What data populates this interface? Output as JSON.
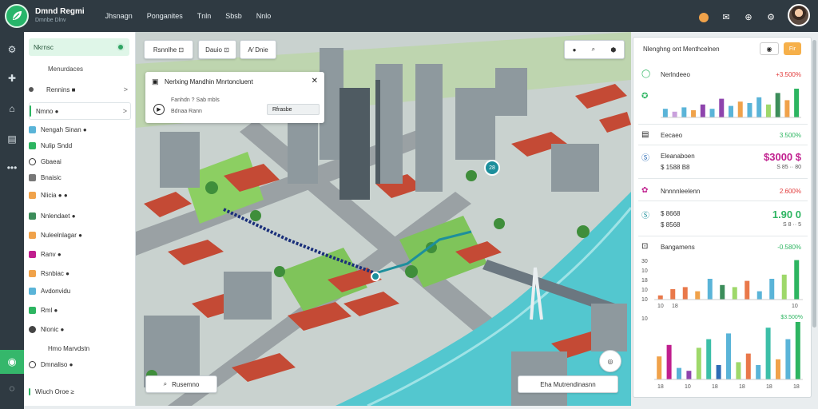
{
  "app": {
    "title": "Dmnd Regmi",
    "subtitle": "Dmnbe Dlnv"
  },
  "topnav": [
    "Jhsnagn",
    "Ponganites",
    "Tnln",
    "Sbsb",
    "Nnlo"
  ],
  "sidebar": {
    "header": "Nkrnsc",
    "menu_label": "Menurdaces",
    "items": [
      {
        "label": "Rennins ■",
        "chevron": ">"
      },
      {
        "label": "Nmno ●",
        "chevron": ">"
      },
      {
        "label": "Nengah Sinan ●"
      },
      {
        "label": "Nulip Sndd"
      },
      {
        "label": "Gbaeai"
      },
      {
        "label": "Bnaisic"
      },
      {
        "label": "Nlicia ● ●"
      },
      {
        "label": "Nnlendaet ●"
      },
      {
        "label": "Nuleelnlagar ●"
      },
      {
        "label": "Ranv ●"
      },
      {
        "label": "Rsnbiac ●"
      },
      {
        "label": "Avdonvidu"
      },
      {
        "label": "Rml ●"
      },
      {
        "label": "Nlonic ●"
      },
      {
        "label": "Hmo Marvdstn"
      },
      {
        "label": "Dmnaliso ●"
      },
      {
        "label": "Wiuch Oroe ≥"
      }
    ]
  },
  "map": {
    "toolbar": [
      "Rsnnlhe ⊡",
      "Dauio ⊡",
      "A⁄  Dnie"
    ],
    "popup": {
      "title": "Nerlxing Mandhin Mnrtoncluent",
      "line1": "Fanhdn ? Sab mbls",
      "line2": "Bdnaa Rann",
      "select": "Rfrasbe"
    },
    "pin_label": "28",
    "search_chip": "Rusemno",
    "bottom_chip": "Eha Mutrendinasnn"
  },
  "panel": {
    "title": "Nlenghng ont Menthcelnen",
    "btn_primary": "Fir",
    "metrics": [
      {
        "label": "Nerlndeeo",
        "value": "+3.500%",
        "color": "#e23b3b",
        "icon": "circle-icon"
      },
      {
        "label": "Eecaeo",
        "value": "3.500%",
        "color": "#2db561",
        "icon": "document-icon"
      },
      {
        "label": "Eleanaboen",
        "big": "$3000 $",
        "sub": "$ 1588 B8",
        "sub2": "S 85 ·· 80",
        "color": "#c01f8e",
        "icon": "dollar-icon"
      },
      {
        "label": "Nnnnnleelenn",
        "value": "2.600%",
        "color": "#e23b3b",
        "icon": "flower-icon"
      },
      {
        "label": "$ 8668",
        "big": "1.90 0",
        "sub": "$ 8568",
        "sub2": "S 8 ·· 5",
        "color": "#2db561",
        "icon": "money-icon"
      },
      {
        "label": "Bangamens",
        "value": "-0.580%",
        "color": "#2db561",
        "icon": "chart-icon"
      }
    ],
    "chart1_bars": [
      {
        "v": 0.3,
        "c": "#5ab4d8"
      },
      {
        "v": 0.2,
        "c": "#c9a0dc"
      },
      {
        "v": 0.35,
        "c": "#5ab4d8"
      },
      {
        "v": 0.25,
        "c": "#f0a24a"
      },
      {
        "v": 0.45,
        "c": "#8e44ad"
      },
      {
        "v": 0.3,
        "c": "#5ab4d8"
      },
      {
        "v": 0.65,
        "c": "#8e44ad"
      },
      {
        "v": 0.4,
        "c": "#5ab4d8"
      },
      {
        "v": 0.55,
        "c": "#f0a24a"
      },
      {
        "v": 0.5,
        "c": "#5ab4d8"
      },
      {
        "v": 0.7,
        "c": "#5ab4d8"
      },
      {
        "v": 0.45,
        "c": "#9ed86a"
      },
      {
        "v": 0.85,
        "c": "#3c8d5a"
      },
      {
        "v": 0.6,
        "c": "#f0a24a"
      },
      {
        "v": 1.0,
        "c": "#2db561"
      }
    ],
    "chart2": {
      "yticks": [
        "30",
        "10",
        "18",
        "10",
        "10"
      ],
      "xticks": [
        "10",
        "18",
        "10"
      ],
      "bars": [
        {
          "v": 0.1,
          "c": "#e9784a"
        },
        {
          "v": 0.25,
          "c": "#e9784a"
        },
        {
          "v": 0.3,
          "c": "#e9784a"
        },
        {
          "v": 0.2,
          "c": "#f0a24a"
        },
        {
          "v": 0.5,
          "c": "#5ab4d8"
        },
        {
          "v": 0.35,
          "c": "#3c8d5a"
        },
        {
          "v": 0.3,
          "c": "#9ed86a"
        },
        {
          "v": 0.45,
          "c": "#e9784a"
        },
        {
          "v": 0.2,
          "c": "#5ab4d8"
        },
        {
          "v": 0.5,
          "c": "#5ab4d8"
        },
        {
          "v": 0.6,
          "c": "#9ed86a"
        },
        {
          "v": 0.95,
          "c": "#2db561"
        }
      ]
    },
    "chart3": {
      "ytop": "10",
      "top_value": "$3.500%",
      "xticks": [
        "18",
        "10",
        "18",
        "18",
        "18",
        "18"
      ],
      "bars": [
        {
          "v": 0.4,
          "c": "#f0a24a"
        },
        {
          "v": 0.6,
          "c": "#c01f8e"
        },
        {
          "v": 0.2,
          "c": "#5ab4d8"
        },
        {
          "v": 0.15,
          "c": "#8e44ad"
        },
        {
          "v": 0.55,
          "c": "#9ed86a"
        },
        {
          "v": 0.7,
          "c": "#3cbfa8"
        },
        {
          "v": 0.25,
          "c": "#2d6cb5"
        },
        {
          "v": 0.8,
          "c": "#5ab4d8"
        },
        {
          "v": 0.3,
          "c": "#9ed86a"
        },
        {
          "v": 0.45,
          "c": "#e9784a"
        },
        {
          "v": 0.25,
          "c": "#5ab4d8"
        },
        {
          "v": 0.9,
          "c": "#3cbfa8"
        },
        {
          "v": 0.35,
          "c": "#f0a24a"
        },
        {
          "v": 0.7,
          "c": "#5ab4d8"
        },
        {
          "v": 1.0,
          "c": "#2db561"
        }
      ]
    }
  }
}
